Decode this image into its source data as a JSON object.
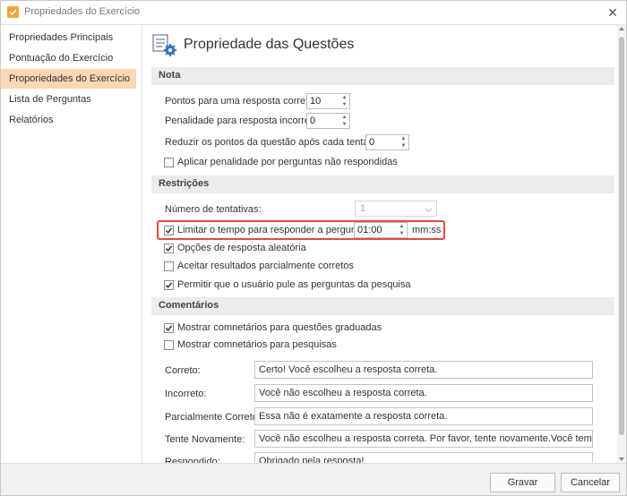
{
  "window": {
    "title": "Propriedades do Exercício"
  },
  "sidebar": {
    "items": [
      {
        "label": "Propriedades Principais"
      },
      {
        "label": "Pontuação do Exercício"
      },
      {
        "label": "Proporiedades do Exercício",
        "active": true
      },
      {
        "label": "Lista de Perguntas"
      },
      {
        "label": "Relatórios"
      }
    ]
  },
  "main": {
    "title": "Propriedade das Questões",
    "nota": {
      "header": "Nota",
      "points_correct_label": "Pontos para uma resposta correta:",
      "points_correct_value": "10",
      "penalty_label": "Penalidade para resposta incorreta:",
      "penalty_value": "0",
      "reduce_label": "Reduzir os pontos da questão após cada tentativa:",
      "reduce_value": "0",
      "apply_penalty_label": "Aplicar penalidade por perguntas não respondidas",
      "apply_penalty_checked": false
    },
    "restricoes": {
      "header": "Restrições",
      "attempts_label": "Número de tentativas:",
      "attempts_value": "1",
      "limit_time_label": "Limitar o tempo para responder a pergunta:",
      "limit_time_checked": true,
      "limit_time_value": "01:00",
      "limit_time_unit": "mm:ss",
      "random_label": "Opções de resposta aleatória",
      "random_checked": true,
      "partial_label": "Aceitar resultados parcialmente corretos",
      "partial_checked": false,
      "skip_label": "Permitir que o usuário pule as perguntas da pesquisa",
      "skip_checked": true
    },
    "comentarios": {
      "header": "Comentários",
      "show_graded_label": "Mostrar comnetários para questões graduadas",
      "show_graded_checked": true,
      "show_survey_label": "Mostrar comnetários para pesquisas",
      "show_survey_checked": false,
      "fields": [
        {
          "label": "Correto:",
          "value": "Certo! Você escolheu a resposta correta."
        },
        {
          "label": "Incorreto:",
          "value": "Você não escolheu a resposta correta."
        },
        {
          "label": "Parcialmente Correto:",
          "value": "Essa não é exatamente a resposta correta."
        },
        {
          "label": "Tente Novamente:",
          "value": "Você não escolheu a resposta correta. Por favor, tente novamente.Você tem %ANSWE"
        },
        {
          "label": "Respondido:",
          "value": "Obrigado pela resposta!"
        }
      ]
    }
  },
  "footer": {
    "save_label": "Gravar",
    "cancel_label": "Cancelar"
  },
  "colors": {
    "accent": "#f3a33a",
    "active_item": "#fbd7b4",
    "highlight_border": "#e64a3c"
  }
}
